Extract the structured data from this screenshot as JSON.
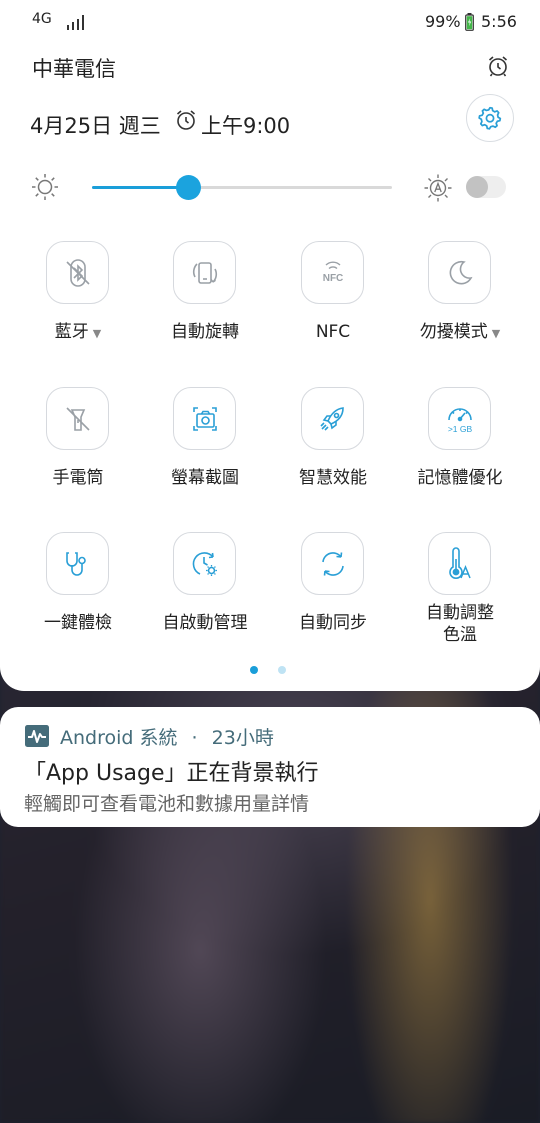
{
  "colors": {
    "accent": "#1a9ed9",
    "icon_blue": "#2a9fd6",
    "icon_gray": "#9aa0a6"
  },
  "status_bar": {
    "network": "4G",
    "battery": "99%",
    "time": "5:56"
  },
  "header": {
    "carrier": "中華電信",
    "date": "4月25日 週三",
    "alarm_time": "上午9:00"
  },
  "brightness": {
    "level": 0.32,
    "auto": false
  },
  "tiles": [
    {
      "label": "藍牙",
      "icon": "bluetooth-off-icon",
      "dropdown": true
    },
    {
      "label": "自動旋轉",
      "icon": "auto-rotate-icon"
    },
    {
      "label": "NFC",
      "icon": "nfc-icon",
      "icon_text": "NFC"
    },
    {
      "label": "勿擾模式",
      "icon": "moon-icon",
      "dropdown": true
    },
    {
      "label": "手電筒",
      "icon": "flashlight-off-icon"
    },
    {
      "label": "螢幕截圖",
      "icon": "screenshot-icon"
    },
    {
      "label": "智慧效能",
      "icon": "rocket-icon"
    },
    {
      "label": "記憶體優化",
      "icon": "memory-speed-icon",
      "icon_text": ">1 GB"
    },
    {
      "label": "一鍵體檢",
      "icon": "stethoscope-icon"
    },
    {
      "label": "自啟動管理",
      "icon": "autostart-gear-icon"
    },
    {
      "label": "自動同步",
      "icon": "sync-icon"
    },
    {
      "label_line1": "自動調整",
      "label_line2": "色溫",
      "icon": "thermometer-a-icon"
    }
  ],
  "pager": {
    "pages": 2,
    "current": 1
  },
  "notification": {
    "app": "Android 系統",
    "separator": "·",
    "age": "23小時",
    "title": "「App Usage」正在背景執行",
    "text": "輕觸即可查看電池和數據用量詳情"
  }
}
